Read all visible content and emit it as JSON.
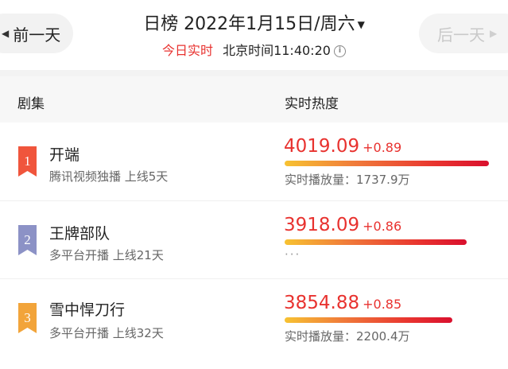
{
  "header": {
    "prev_label": "前一天",
    "next_label": "后一天",
    "title": "日榜 2022年1月15日/周六",
    "today_label": "今日实时",
    "clock_text": "北京时间11:40:20"
  },
  "columns": {
    "series_label": "剧集",
    "heat_label": "实时热度"
  },
  "rows": [
    {
      "rank": "1",
      "name": "开端",
      "meta": "腾讯视频独播  上线5天",
      "heat": "4019.09",
      "delta": "+0.89",
      "bar_fraction": 1.0,
      "play_label": "实时播放量：1737.9万",
      "rank_color": "#f0553c"
    },
    {
      "rank": "2",
      "name": "王牌部队",
      "meta": "多平台开播  上线21天",
      "heat": "3918.09",
      "delta": "+0.86",
      "bar_fraction": 0.89,
      "play_label": "···",
      "rank_color": "#8c92c6"
    },
    {
      "rank": "3",
      "name": "雪中悍刀行",
      "meta": "多平台开播  上线32天",
      "heat": "3854.88",
      "delta": "+0.85",
      "bar_fraction": 0.82,
      "play_label": "实时播放量：2200.4万",
      "rank_color": "#f2a43a"
    }
  ],
  "colors": {
    "accent_red": "#e8322f",
    "bar_start": "#f7c232",
    "bar_end": "#d9102e"
  }
}
